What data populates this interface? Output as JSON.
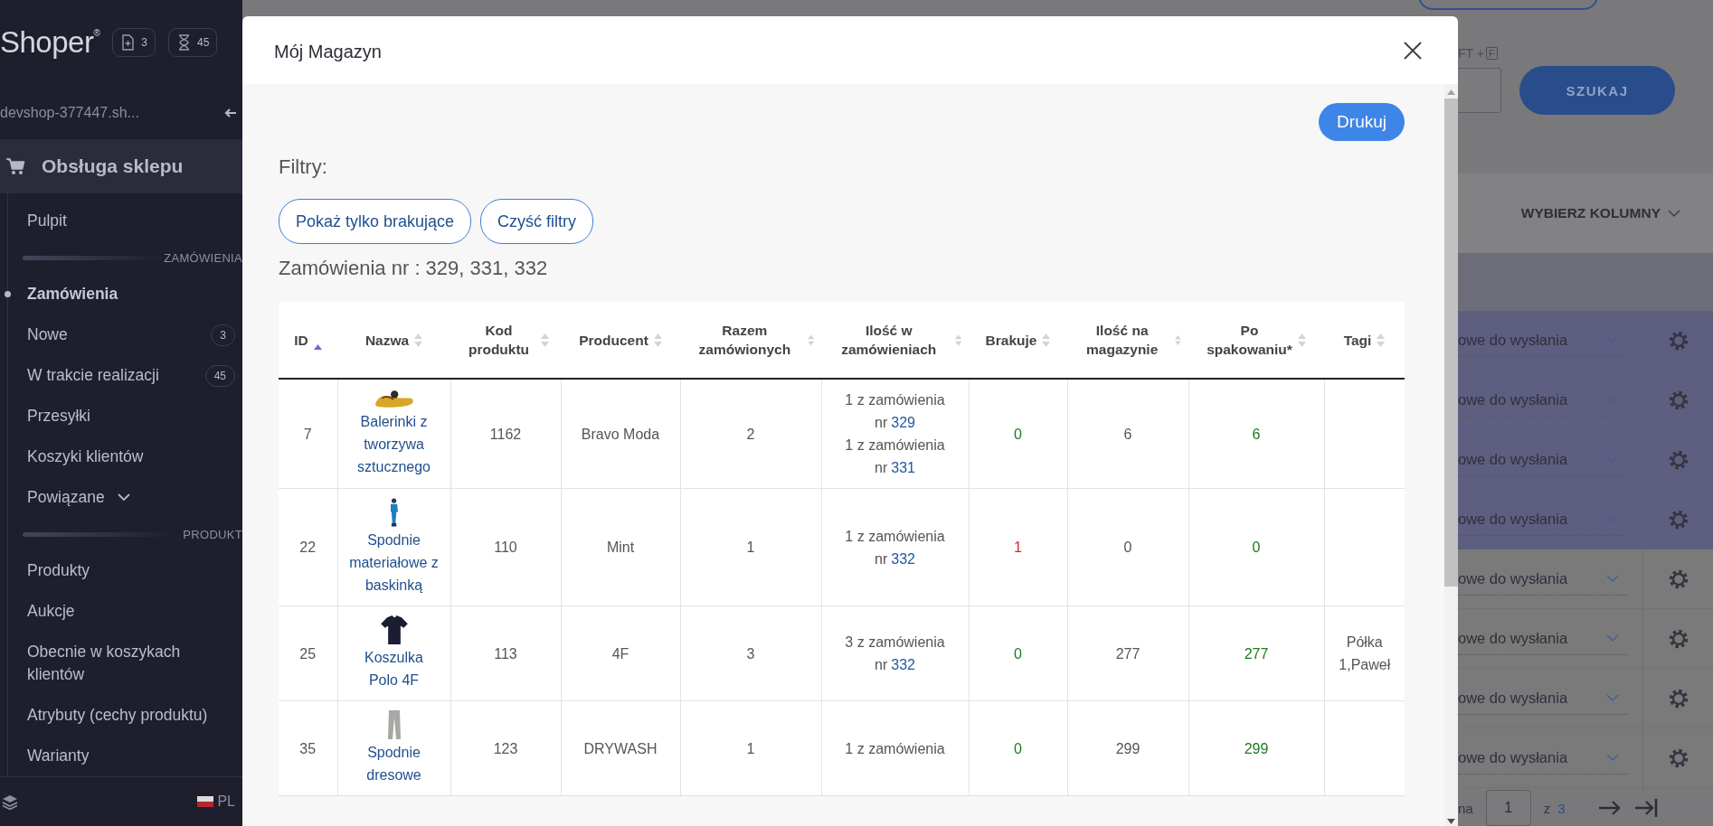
{
  "sidebar": {
    "logo": "Shoper$^{®}$",
    "badges": [
      {
        "kind": "new",
        "count": "3"
      },
      {
        "kind": "pending",
        "count": "45"
      }
    ],
    "shop": "devshop-377447.sh...",
    "section": "Obsługa sklepu",
    "items": [
      {
        "kind": "link",
        "label": "Pulpit",
        "selected": false
      },
      {
        "kind": "heading",
        "label": "ZAMÓWIENIA"
      },
      {
        "kind": "link",
        "label": "Zamówienia",
        "selected": true
      },
      {
        "kind": "link",
        "label": "Nowe",
        "badge": "3",
        "selected": false
      },
      {
        "kind": "link",
        "label": "W trakcie realizacji",
        "badge": "45",
        "selected": false
      },
      {
        "kind": "link",
        "label": "Przesyłki",
        "selected": false
      },
      {
        "kind": "link",
        "label": "Koszyki klientów",
        "selected": false
      },
      {
        "kind": "group",
        "label": "Powiązane",
        "expanded": false,
        "selected": false
      },
      {
        "kind": "heading",
        "label": "PRODUKT"
      },
      {
        "kind": "link",
        "label": "Produkty",
        "selected": false
      },
      {
        "kind": "link",
        "label": "Aukcje",
        "selected": false
      },
      {
        "kind": "link",
        "label": "Obecnie w koszykach klientów",
        "selected": false
      },
      {
        "kind": "link",
        "label": "Atrybuty (cechy produktu)",
        "selected": false
      },
      {
        "kind": "link",
        "label": "Warianty",
        "selected": false
      }
    ],
    "language": "PL"
  },
  "background": {
    "shortcut_prefix": "FT +",
    "shortcut_key": "F",
    "search_button": "SZUKAJ",
    "columns_button": "WYBIERZ KOLUMNY",
    "rows": [
      {
        "status": "owe do wysłania",
        "highlighted": true
      },
      {
        "status": "owe do wysłania",
        "highlighted": true
      },
      {
        "status": "owe do wysłania",
        "highlighted": true
      },
      {
        "status": "owe do wysłania",
        "highlighted": true
      },
      {
        "status": "owe do wysłania",
        "highlighted": false
      },
      {
        "status": "owe do wysłania",
        "highlighted": false
      },
      {
        "status": "owe do wysłania",
        "highlighted": false
      },
      {
        "status": "owe do wysłania",
        "highlighted": false
      }
    ],
    "pagination": {
      "label": "na",
      "page": "1",
      "of": "z",
      "total": "3"
    }
  },
  "modal": {
    "title": "Mój Magazyn",
    "print_button": "Drukuj",
    "filters_label": "Filtry:",
    "filter_buttons": [
      "Pokaż tylko brakujące",
      "Czyść filtry"
    ],
    "orders_line": "Zamówienia nr : 329, 331, 332",
    "table": {
      "columns": [
        {
          "label": "ID",
          "sorted": true
        },
        {
          "label": "Nazwa",
          "sorted": false
        },
        {
          "label": "Kod produktu",
          "sorted": false
        },
        {
          "label": "Producent",
          "sorted": false
        },
        {
          "label": "Razem zamówionych",
          "sorted": false
        },
        {
          "label": "Ilość w zamówieniach",
          "sorted": false
        },
        {
          "label": "Brakuje",
          "sorted": false
        },
        {
          "label": "Ilość na magazynie",
          "sorted": false
        },
        {
          "label": "Po spakowaniu*",
          "sorted": false
        },
        {
          "label": "Tagi",
          "sorted": false
        }
      ],
      "rows": [
        {
          "id": "7",
          "kind": "shoe",
          "name": "Balerinki z tworzywa sztucznego",
          "code": "1162",
          "producer": "Bravo Moda",
          "total": "2",
          "orders": [
            {
              "text": "1 z zamówienia",
              "prefix": "nr",
              "number": "329"
            },
            {
              "text": "1 z zamówienia",
              "prefix": "nr",
              "number": "331"
            }
          ],
          "missing": "0",
          "short": false,
          "stock": "6",
          "packed": "6"
        },
        {
          "id": "22",
          "kind": "figure",
          "name": "Spodnie materiałowe z baskinką",
          "code": "110",
          "producer": "Mint",
          "total": "1",
          "orders": [
            {
              "text": "1 z zamówienia",
              "prefix": "nr",
              "number": "332"
            }
          ],
          "missing": "1",
          "short": true,
          "stock": "0",
          "packed": "0"
        },
        {
          "id": "25",
          "kind": "tshirt",
          "name": "Koszulka Polo 4F",
          "code": "113",
          "producer": "4F",
          "total": "3",
          "orders": [
            {
              "text": "3 z zamówienia",
              "prefix": "nr",
              "number": "332"
            }
          ],
          "missing": "0",
          "short": false,
          "stock": "277",
          "packed": "277",
          "tags": "Półka 1,Paweł"
        },
        {
          "id": "35",
          "kind": "trousers",
          "name": "Spodnie dresowe",
          "code": "123",
          "producer": "DRYWASH",
          "total": "1",
          "orders": [
            {
              "text": "1 z zamówienia"
            }
          ],
          "missing": "0",
          "short": false,
          "stock": "299",
          "packed": "299"
        }
      ]
    }
  }
}
